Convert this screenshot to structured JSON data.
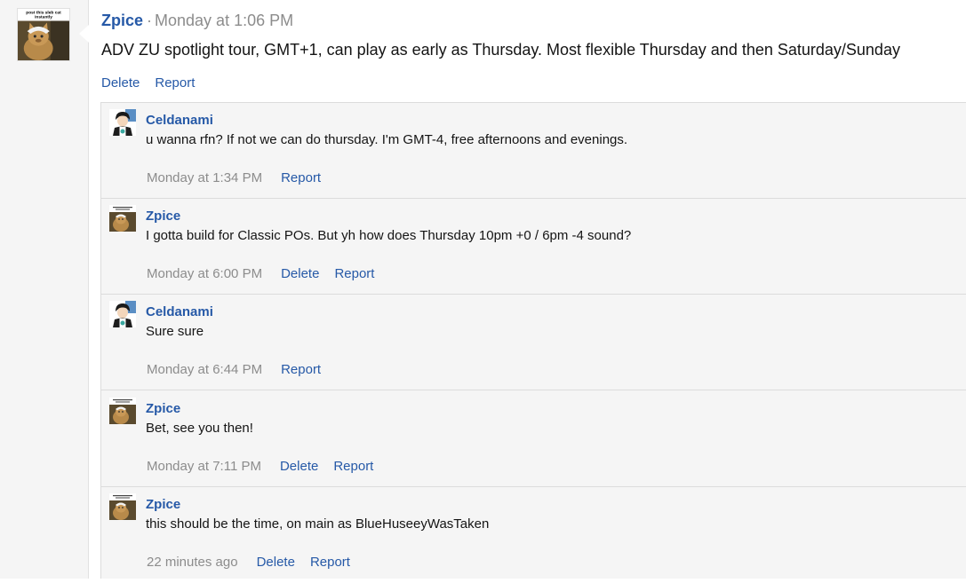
{
  "post": {
    "author": "Zpice",
    "separator": "·",
    "time": "Monday at 1:06 PM",
    "body": "ADV ZU spotlight tour, GMT+1, can play as early as Thursday. Most flexible Thursday and then Saturday/Sunday",
    "avatar_caption_line1": "post this sleb cat",
    "avatar_caption_line2": "instantly",
    "actions": {
      "delete": "Delete",
      "report": "Report"
    }
  },
  "replies": [
    {
      "author": "Celdanami",
      "text": "u wanna rfn? If not we can do thursday. I'm GMT-4, free afternoons and evenings.",
      "time": "Monday at 1:34 PM",
      "report": "Report"
    },
    {
      "author": "Zpice",
      "text": "I gotta build for Classic POs. But yh how does Thursday 10pm +0 / 6pm -4 sound?",
      "time": "Monday at 6:00 PM",
      "delete": "Delete",
      "report": "Report"
    },
    {
      "author": "Celdanami",
      "text": "Sure sure",
      "time": "Monday at 6:44 PM",
      "report": "Report"
    },
    {
      "author": "Zpice",
      "text": "Bet, see you then!",
      "time": "Monday at 7:11 PM",
      "delete": "Delete",
      "report": "Report"
    },
    {
      "author": "Zpice",
      "text": "this should be the time, on main as BlueHuseeyWasTaken",
      "time": "22 minutes ago",
      "delete": "Delete",
      "report": "Report"
    }
  ],
  "colors": {
    "link": "#2659a7",
    "muted": "#8c8c8c",
    "reply_bg": "#f5f5f5"
  },
  "icons": {
    "zpice_avatar": "cat-meme-avatar",
    "celdanami_avatar": "anime-character-avatar"
  }
}
